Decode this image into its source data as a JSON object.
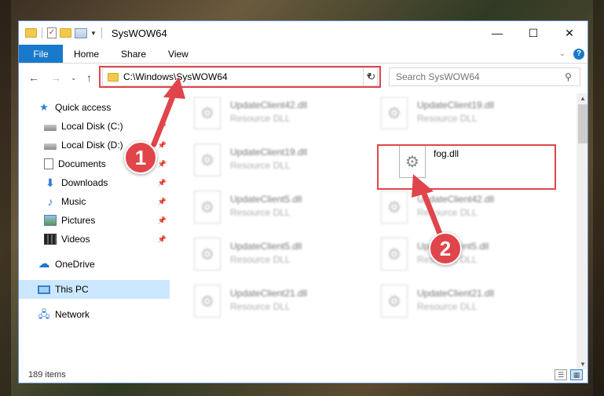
{
  "window": {
    "title": "SysWOW64",
    "controls": {
      "minimize": "—",
      "maximize": "☐",
      "close": "✕"
    }
  },
  "ribbon": {
    "tabs": [
      {
        "label": "File"
      },
      {
        "label": "Home"
      },
      {
        "label": "Share"
      },
      {
        "label": "View"
      }
    ]
  },
  "address": {
    "path": "C:\\Windows\\SysWOW64",
    "search_placeholder": "Search SysWOW64"
  },
  "navigation": {
    "items": [
      {
        "label": "Quick access",
        "icon": "star-icon",
        "pinned": false
      },
      {
        "label": "Local Disk (C:)",
        "icon": "disk-icon",
        "pinned": true
      },
      {
        "label": "Local Disk (D:)",
        "icon": "disk-icon",
        "pinned": true
      },
      {
        "label": "Documents",
        "icon": "documents-icon",
        "pinned": true
      },
      {
        "label": "Downloads",
        "icon": "downloads-icon",
        "pinned": true
      },
      {
        "label": "Music",
        "icon": "music-icon",
        "pinned": true
      },
      {
        "label": "Pictures",
        "icon": "pictures-icon",
        "pinned": true
      },
      {
        "label": "Videos",
        "icon": "videos-icon",
        "pinned": true
      },
      {
        "label": "OneDrive",
        "icon": "onedrive-icon",
        "pinned": false
      },
      {
        "label": "This PC",
        "icon": "this-pc-icon",
        "pinned": false,
        "selected": true
      },
      {
        "label": "Network",
        "icon": "network-icon",
        "pinned": false
      }
    ]
  },
  "files": [
    {
      "name": "UpdateClient42.dll",
      "type": "Resource DLL"
    },
    {
      "name": "UpdateClient19.dll",
      "type": "Resource DLL"
    },
    {
      "name": "UpdateClient19.dll",
      "type": "Resource DLL"
    },
    {
      "name": "fog.dll",
      "type": ""
    },
    {
      "name": "UpdateClient5.dll",
      "type": "Resource DLL"
    },
    {
      "name": "UpdateClient42.dll",
      "type": "Resource DLL"
    },
    {
      "name": "UpdateClient5.dll",
      "type": "Resource DLL"
    },
    {
      "name": "UpdateClient5.dll",
      "type": "Resource DLL"
    },
    {
      "name": "UpdateClient21.dll",
      "type": "Resource DLL"
    },
    {
      "name": "UpdateClient21.dll",
      "type": "Resource DLL"
    }
  ],
  "status": {
    "item_count": "189 items"
  },
  "callouts": {
    "step1": "1",
    "step2": "2"
  },
  "colors": {
    "accent": "#1979ca",
    "highlight": "#e0454b",
    "selection": "#cce8ff"
  }
}
